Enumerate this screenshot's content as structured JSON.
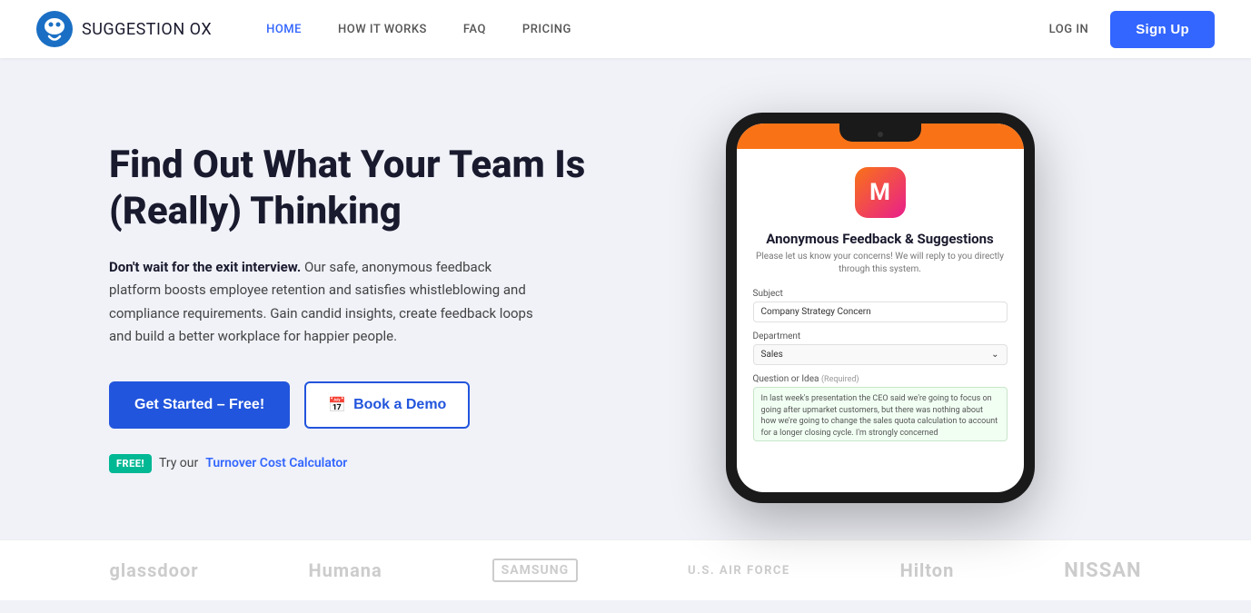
{
  "nav": {
    "logo_text": "SUGGESTION",
    "logo_suffix": " OX",
    "links": [
      {
        "label": "HOME",
        "active": true,
        "id": "home"
      },
      {
        "label": "HOW IT WORKS",
        "active": false,
        "id": "how-it-works"
      },
      {
        "label": "FAQ",
        "active": false,
        "id": "faq"
      },
      {
        "label": "PRICING",
        "active": false,
        "id": "pricing"
      },
      {
        "label": "LOG IN",
        "active": false,
        "id": "login"
      }
    ],
    "signup_label": "Sign Up"
  },
  "hero": {
    "title": "Find Out What Your Team Is (Really) Thinking",
    "desc_bold": "Don't wait for the exit interview.",
    "desc_text": " Our safe, anonymous feedback platform boosts employee retention and satisfies whistleblowing and compliance requirements. Gain candid insights, create feedback loops and build a better workplace for happier people.",
    "btn_primary": "Get Started – Free!",
    "btn_secondary_icon": "📅",
    "btn_secondary": "Book a Demo",
    "free_badge": "FREE!",
    "free_text": "Try our",
    "free_link": "Turnover Cost Calculator"
  },
  "phone": {
    "app_letter": "M",
    "form_title": "Anonymous Feedback & Suggestions",
    "form_subtitle": "Please let us know your concerns! We will reply to you directly through this system.",
    "subject_label": "Subject",
    "subject_value": "Company Strategy Concern",
    "department_label": "Department",
    "department_value": "Sales",
    "question_label": "Question or Idea",
    "question_required": "(Required)",
    "question_value": "In last week's presentation the CEO said we're going to focus on going after upmarket customers, but there was nothing about how we're going to change the sales quota calculation to account for a longer closing cycle. I'm strongly concerned"
  },
  "brands": [
    {
      "label": "glassdoor",
      "class": ""
    },
    {
      "label": "Humana",
      "class": ""
    },
    {
      "label": "SAMSUNG",
      "class": "samsung"
    },
    {
      "label": "U.S. AIR FORCE",
      "class": "airforce"
    },
    {
      "label": "Hilton",
      "class": ""
    },
    {
      "label": "NISSAN",
      "class": ""
    }
  ]
}
